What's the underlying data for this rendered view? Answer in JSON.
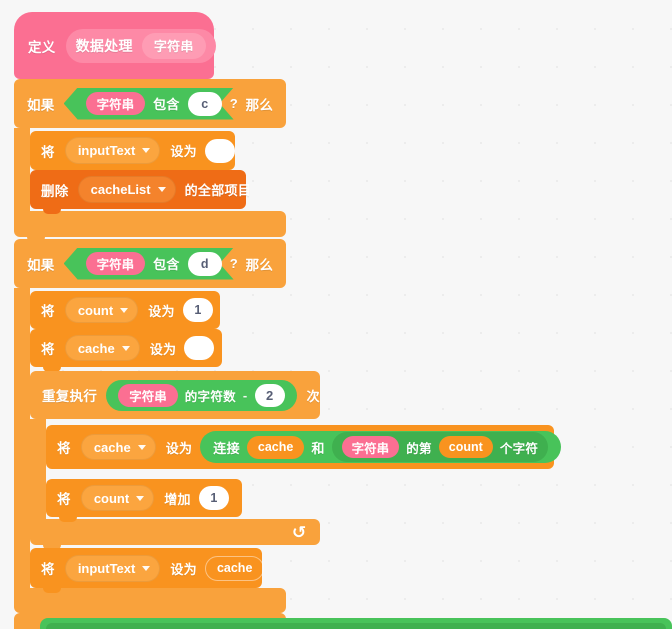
{
  "canvas": {
    "background_color": "#f7f7f7",
    "grid": "dot-grid"
  },
  "palette": {
    "define_pink": "#fb6f92",
    "control_orange": "#f9a23c",
    "variable_orange": "#f9931f",
    "list_orange": "#ef6c16",
    "operator_green": "#48c35a",
    "input_white": "#ffffff"
  },
  "script": {
    "define_block": {
      "keyword": "定义",
      "proc_name": "数据处理",
      "param": "字符串"
    },
    "if_block_1": {
      "if_label": "如果",
      "then_label": "那么",
      "condition": {
        "subject": "字符串",
        "predicate": "包含",
        "value": "c",
        "question_mark": "?"
      },
      "body": [
        {
          "kind": "set-variable",
          "set_label": "将",
          "variable": "inputText",
          "to_label": "设为",
          "value": ""
        },
        {
          "kind": "delete-all-of-list",
          "delete_label": "删除",
          "list": "cacheList",
          "suffix_label": "的全部项目"
        }
      ]
    },
    "if_block_2": {
      "if_label": "如果",
      "then_label": "那么",
      "condition": {
        "subject": "字符串",
        "predicate": "包含",
        "value": "d",
        "question_mark": "?"
      },
      "body": [
        {
          "kind": "set-variable",
          "set_label": "将",
          "variable": "count",
          "to_label": "设为",
          "value": "1"
        },
        {
          "kind": "set-variable",
          "set_label": "将",
          "variable": "cache",
          "to_label": "设为",
          "value": ""
        },
        {
          "kind": "repeat",
          "repeat_label": "重复执行",
          "times_label": "次",
          "count_expression": {
            "operator": "-",
            "left": {
              "reporter": "字符串",
              "suffix": "的字符数"
            },
            "right": "2"
          },
          "body": [
            {
              "kind": "set-variable-join",
              "set_label": "将",
              "variable": "cache",
              "to_label": "设为",
              "join_label": "连接",
              "join_a": "cache",
              "and_label": "和",
              "letter_of": {
                "string": "字符串",
                "prefix": "的第",
                "index": "count",
                "suffix": "个字符"
              }
            },
            {
              "kind": "change-variable",
              "set_label": "将",
              "variable": "count",
              "change_label": "增加",
              "value": "1"
            }
          ],
          "loop_icon": "loop-arrow-icon"
        },
        {
          "kind": "set-variable",
          "set_label": "将",
          "variable": "inputText",
          "to_label": "设为",
          "value_reporter": "cache"
        }
      ]
    }
  }
}
